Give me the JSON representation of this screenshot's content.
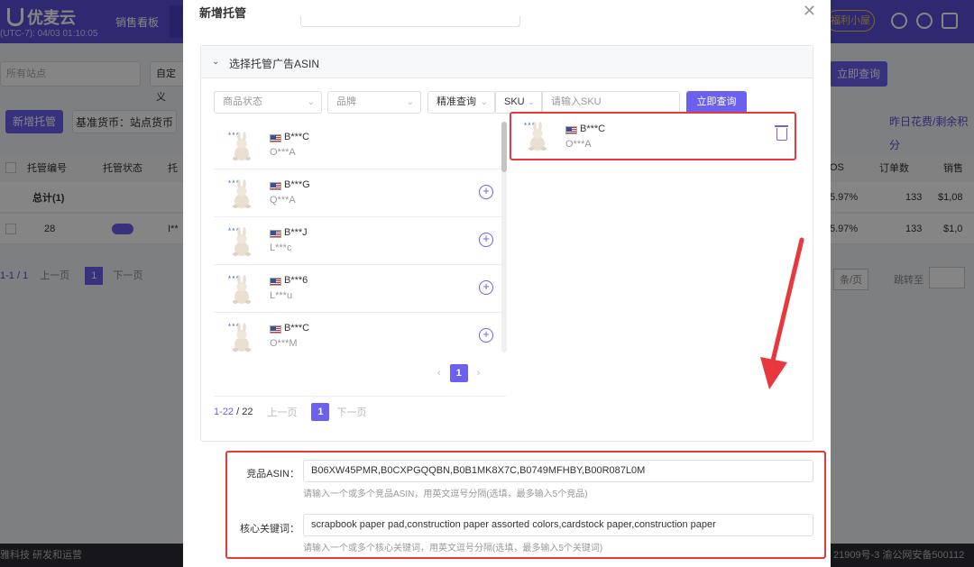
{
  "background": {
    "brand": "优麦云",
    "time": "(UTC-7): 04/03 01:10:05",
    "nav_item": "销售看板",
    "welfare_badge": "福利小屋",
    "site_select": "所有站点",
    "custom_select": "自定义",
    "query_button": "立即查询",
    "new_button": "新增托管",
    "currency_button": "基准货币：站点货币",
    "yesterday_text": "昨日花费/剩余积分",
    "columns": [
      "托管编号",
      "托管状态",
      "托",
      "OS",
      "订单数",
      "销售"
    ],
    "total_label": "总计(1)",
    "total_row": {
      "acos": "5.97%",
      "orders": "133",
      "sales": "$1,08"
    },
    "row": {
      "id": "28",
      "name": "I**",
      "acos": "5.97%",
      "orders": "133",
      "sales": "$1,0"
    },
    "pager": {
      "range": "1-1 / 1",
      "prev": "上一页",
      "page": "1",
      "next": "下一页"
    },
    "per_page": "条/页",
    "goto": "跳转至",
    "footer_left": "雅科技 研发和运营",
    "footer_right": "21909号-3  渝公网安备500112"
  },
  "modal": {
    "title": "新增托管",
    "close_icon": "close-icon",
    "section_title": "选择托管广告ASIN",
    "filters": {
      "status_placeholder": "商品状态",
      "brand_placeholder": "品牌",
      "match_mode": "精准查询",
      "field_type": "SKU",
      "search_placeholder": "请输入SKU",
      "query_button": "立即查询"
    },
    "product_list": [
      {
        "asin": "B***C",
        "shop": "O***A"
      },
      {
        "asin": "B***G",
        "shop": "Q***A"
      },
      {
        "asin": "B***J",
        "shop": "L***c"
      },
      {
        "asin": "B***6",
        "shop": "L***u"
      },
      {
        "asin": "B***C",
        "shop": "O***M"
      }
    ],
    "inner_page": "1",
    "list_pager": {
      "range": "1-22",
      "total": "22",
      "prev": "上一页",
      "page": "1",
      "next": "下一页"
    },
    "selected": {
      "asin": "B***C",
      "shop": "O***A"
    },
    "competitor_label": "竞品ASIN：",
    "competitor_value": "B06XW45PMR,B0CXPGQQBN,B0B1MK8X7C,B0749MFHBY,B00R087L0M",
    "competitor_hint": "请输入一个或多个竞品ASIN，用英文逗号分隔(选填，最多输入5个竞品)",
    "keyword_label": "核心关键词：",
    "keyword_value": "scrapbook paper pad,construction paper assorted colors,cardstock paper,construction paper",
    "keyword_hint": "请输入一个或多个核心关键词，用英文逗号分隔(选填，最多输入5个关键词)"
  },
  "colors": {
    "primary": "#6c60f0",
    "highlight": "#e8383d",
    "brand_bar": "#5b4fd9"
  }
}
